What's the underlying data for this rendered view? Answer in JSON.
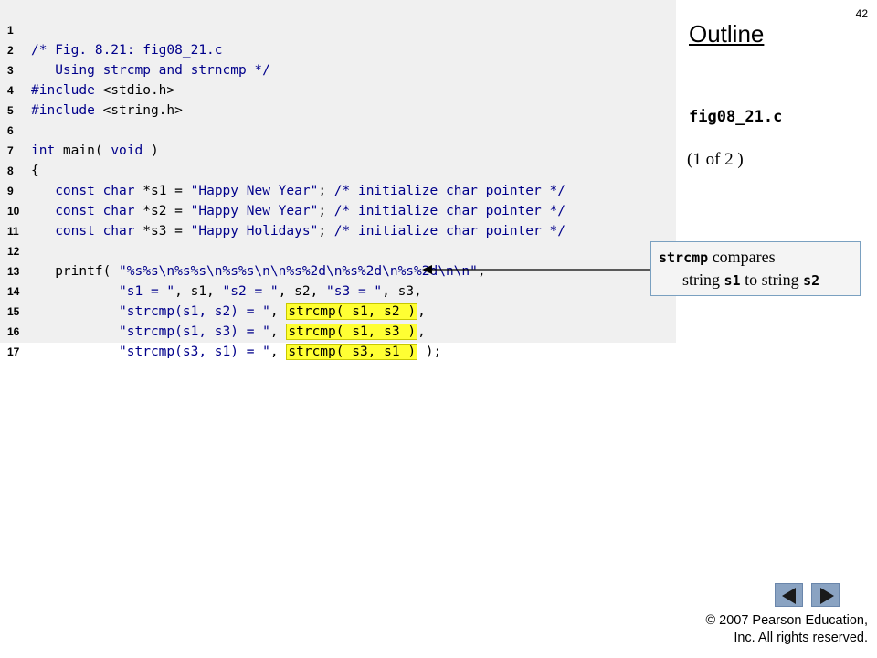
{
  "page_number": "42",
  "outline": {
    "title": "Outline",
    "file_name": "fig08_21.c",
    "part": "(1 of 2 )"
  },
  "code": {
    "line_numbers": [
      "1",
      "2",
      "3",
      "4",
      "5",
      "6",
      "7",
      "8",
      "9",
      "10",
      "11",
      "12",
      "13",
      "14",
      "15",
      "16",
      "17"
    ],
    "l1": "/* Fig. 8.21: fig08_21.c",
    "l2": "   Using strcmp and strncmp */",
    "l3_kw": "#include",
    "l3_rest": " <stdio.h>",
    "l4_kw": "#include",
    "l4_rest": " <string.h>",
    "l6_kw": "int",
    "l6_mid": " main( ",
    "l6_kw2": "void",
    "l6_end": " )",
    "l7": "{",
    "l8_pre": "   ",
    "l8_kw": "const char",
    "l8_var": " *s1 = ",
    "l8_str": "\"Happy New Year\"",
    "l8_sep": "; ",
    "l8_cm": "/* initialize char pointer */",
    "l9_pre": "   ",
    "l9_kw": "const char",
    "l9_var": " *s2 = ",
    "l9_str": "\"Happy New Year\"",
    "l9_sep": "; ",
    "l9_cm": "/* initialize char pointer */",
    "l10_pre": "   ",
    "l10_kw": "const char",
    "l10_var": " *s3 = ",
    "l10_str": "\"Happy Holidays\"",
    "l10_sep": "; ",
    "l10_cm": "/* initialize char pointer */",
    "l12_pre": "   printf( ",
    "l12_str": "\"%s%s\\n%s%s\\n%s%s\\n\\n%s%2d\\n%s%2d\\n%s%2d\\n\\n\"",
    "l12_end": ",",
    "l13_pre": "           ",
    "l13_s1": "\"s1 = \"",
    "l13_a": ", s1, ",
    "l13_s2": "\"s2 = \"",
    "l13_b": ", s2, ",
    "l13_s3": "\"s3 = \"",
    "l13_c": ", s3,",
    "l14_pre": "           ",
    "l14_str": "\"strcmp(s1, s2) = \"",
    "l14_sep": ", ",
    "l14_hl": "strcmp( s1, s2 )",
    "l14_end": ",",
    "l15_pre": "           ",
    "l15_str": "\"strcmp(s1, s3) = \"",
    "l15_sep": ", ",
    "l15_hl": "strcmp( s1, s3 )",
    "l15_end": ",",
    "l16_pre": "           ",
    "l16_str": "\"strcmp(s3, s1) = \"",
    "l16_sep": ", ",
    "l16_hl": "strcmp( s3, s1 )",
    "l16_end": " );"
  },
  "callout": {
    "fn": "strcmp",
    "text1": " compares",
    "text2a": "string ",
    "arg1": "s1",
    "text2b": " to string ",
    "arg2": "s2"
  },
  "nav": {
    "prev_icon": "left-arrow-icon",
    "next_icon": "right-arrow-icon"
  },
  "copyright": {
    "line1": "© 2007 Pearson Education,",
    "line2": "Inc.  All rights reserved."
  },
  "colors": {
    "code_background": "#f0f0f0",
    "keyword_blue": "#00008b",
    "highlight_yellow": "#ffff33",
    "nav_button": "#8aa3c2"
  }
}
